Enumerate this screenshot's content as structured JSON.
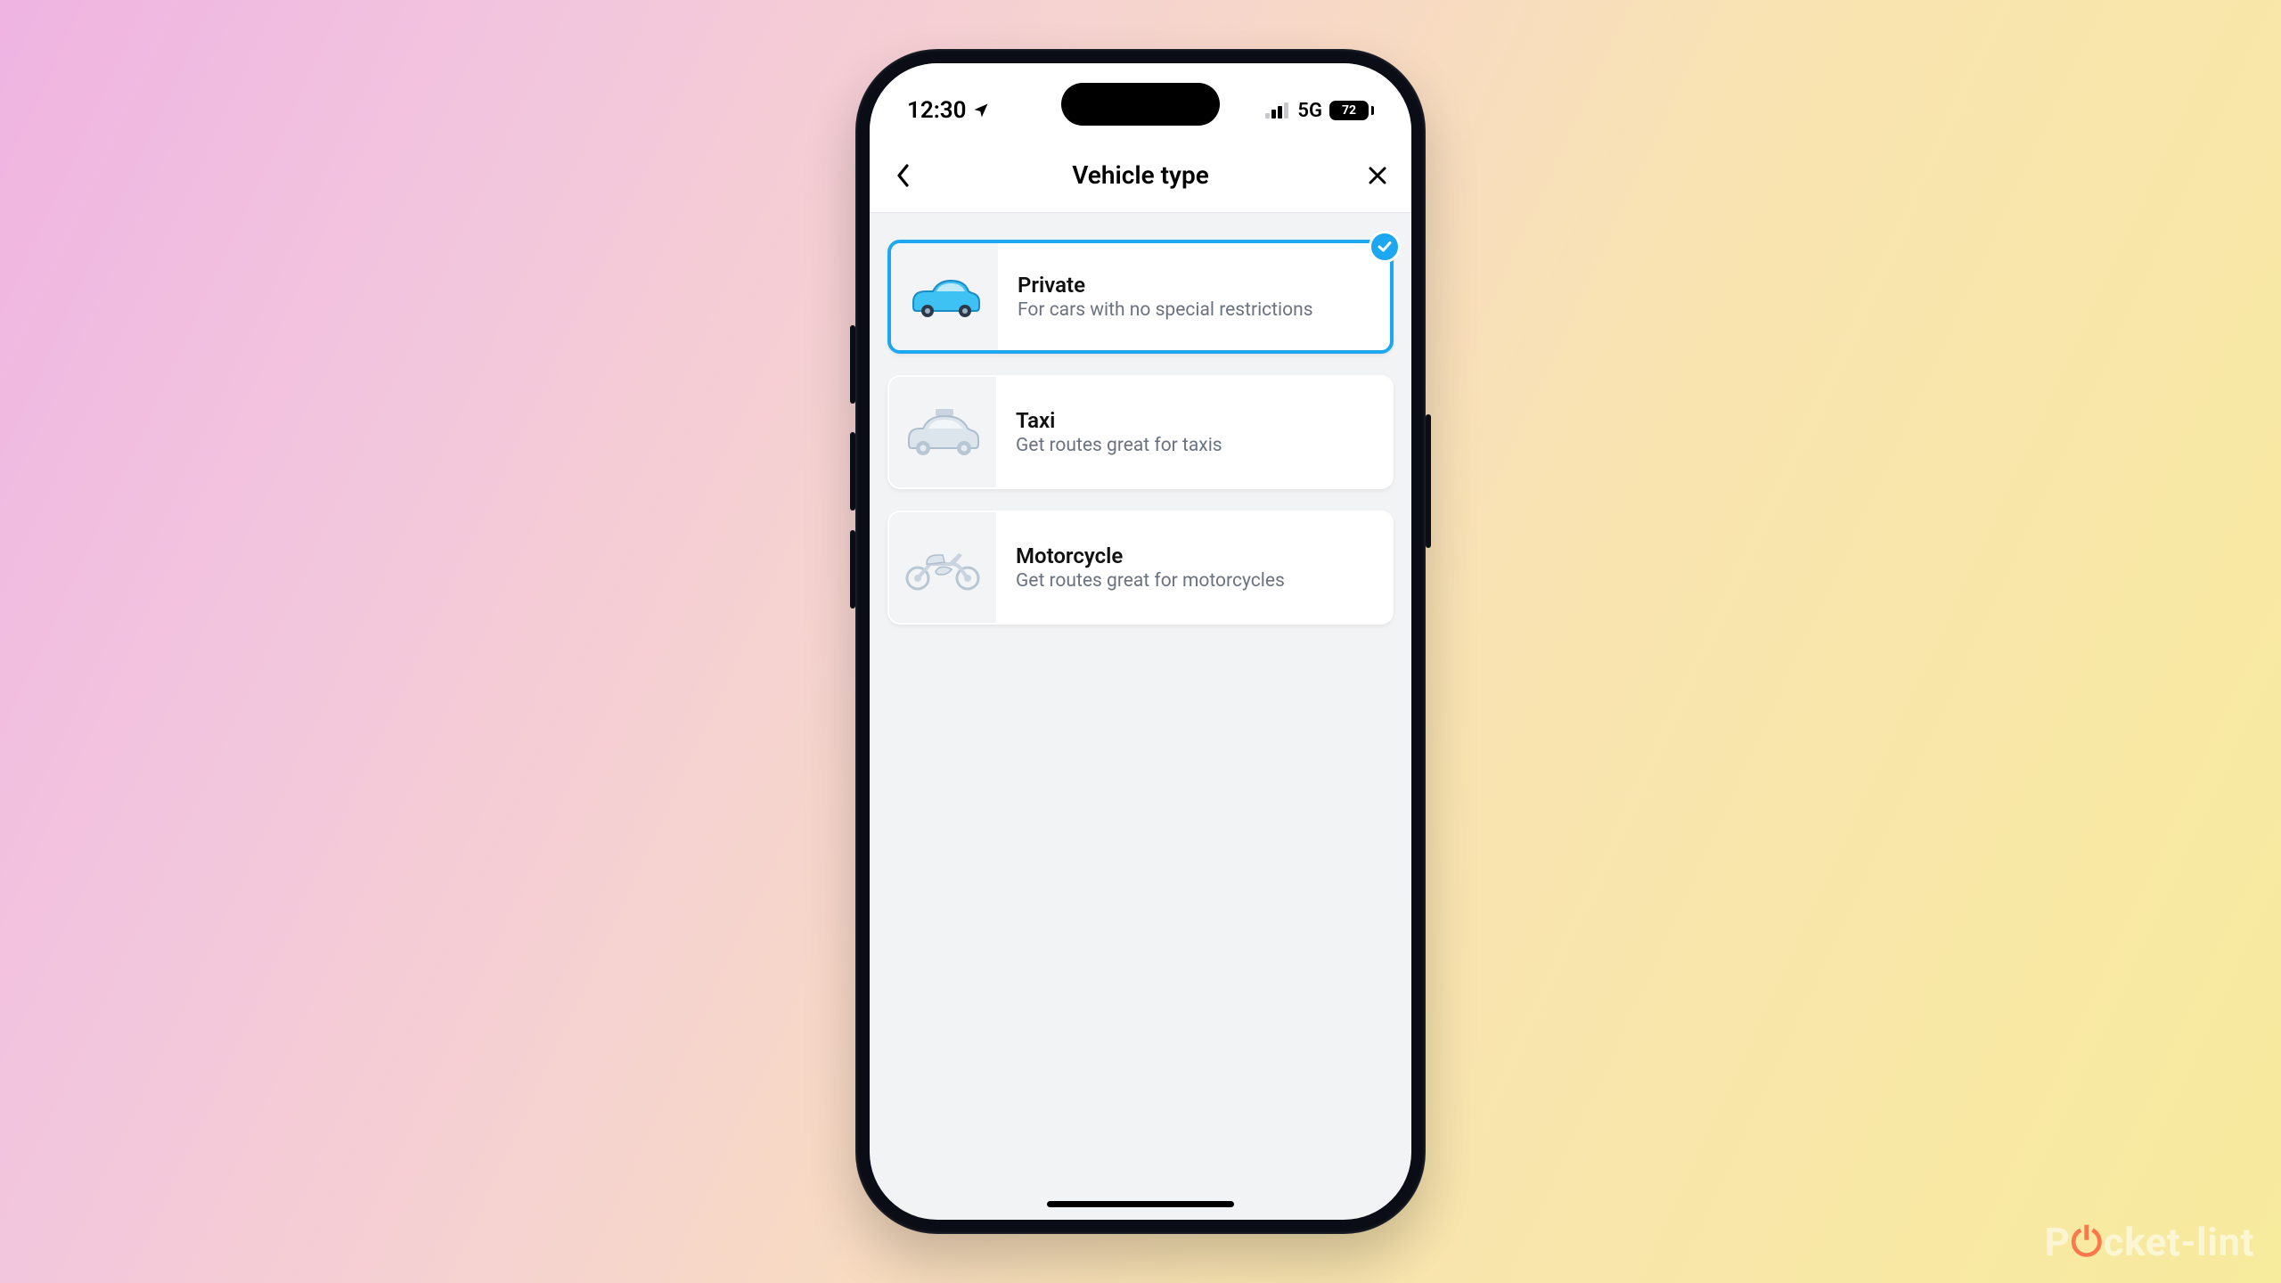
{
  "statusbar": {
    "time": "12:30",
    "network_label": "5G",
    "battery_pct": "72"
  },
  "nav": {
    "title": "Vehicle type"
  },
  "vehicle_options": [
    {
      "title": "Private",
      "subtitle": "For cars with no special restrictions",
      "selected": true,
      "icon": "car"
    },
    {
      "title": "Taxi",
      "subtitle": "Get routes great for taxis",
      "selected": false,
      "icon": "taxi"
    },
    {
      "title": "Motorcycle",
      "subtitle": "Get routes great for motorcycles",
      "selected": false,
      "icon": "motorcycle"
    }
  ],
  "watermark": {
    "prefix": "P",
    "accent": "o",
    "suffix": "cket-lint"
  }
}
